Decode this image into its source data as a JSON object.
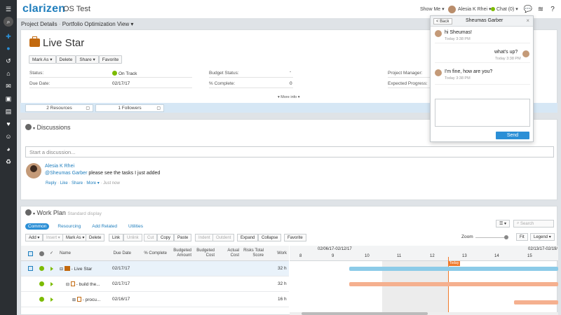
{
  "app": {
    "logo_text": "clarizen",
    "title": "OS Test"
  },
  "header": {
    "show_me": "Show Me ▾",
    "user_name": "Alesia K Rhei ▾",
    "chat_label": "Chat (0) ▾"
  },
  "breadcrumb": {
    "project_details": "Project Details",
    "separator": "·",
    "view": "Portfolio Optimization View ▾"
  },
  "project": {
    "title": "Live Star",
    "actions": [
      "Mark As ▾",
      "Delete",
      "Share ▾",
      "Favorite"
    ],
    "fields": {
      "status_label": "Status:",
      "status_value": "On Track",
      "due_label": "Due Date:",
      "due_value": "02/17/17",
      "budget_status_label": "Budget Status:",
      "budget_status_value": "-",
      "pct_complete_label": "% Complete:",
      "pct_complete_value": "0",
      "manager_label": "Project Manager:",
      "expected_label": "Expected Progress:"
    },
    "more_info": "▾ More info ▾",
    "resources": "2 Resources",
    "followers": "1 Followers"
  },
  "discussions": {
    "title": "Discussions",
    "placeholder": "Start a discussion...",
    "post": {
      "author": "Alesia K Rhei",
      "mention": "@Sheumas Garber",
      "text": " please see the tasks I just added",
      "actions": {
        "reply": "Reply",
        "like": "Like",
        "share": "Share",
        "more": "More ▾",
        "time": "Just now"
      },
      "dot": "·"
    }
  },
  "chat": {
    "back": "< Back",
    "name": "Sheumas Garber",
    "close": "×",
    "messages": [
      {
        "text": "hi Sheumas!",
        "time": "Today 3:38 PM"
      },
      {
        "text": "what's up?",
        "time": "Today 3:38 PM"
      },
      {
        "text": "I'm fine, how are you?",
        "time": "Today 3:38 PM"
      }
    ],
    "send": "Send"
  },
  "workplan": {
    "title": "Work Plan",
    "subtitle": "Standard display",
    "tabs": [
      "Common",
      "Resourcing",
      "Add Related",
      "Utilities"
    ],
    "toolbar": [
      "Add ▾",
      "Insert ▾",
      "Mark As ▾",
      "Delete",
      "Link",
      "Unlink",
      "Cut",
      "Copy",
      "Paste",
      "Indent",
      "Outdent",
      "Expand",
      "Collapse",
      "Favorite"
    ],
    "search_placeholder": "Search",
    "zoom_label": "Zoom",
    "fit": "Fit",
    "legend": "Legend ▾",
    "columns": [
      "Name",
      "Due Date",
      "% Complete",
      "Budgeted Amount",
      "Budgeted Cost",
      "Actual Cost",
      "Risks Total Score",
      "Work"
    ],
    "gantt_weeks": [
      "02/06/17-02/12/17",
      "02/13/17-02/19/"
    ],
    "gantt_days": [
      "8",
      "9",
      "10",
      "11",
      "12",
      "13",
      "14",
      "15"
    ],
    "today_label": "Today",
    "rows": [
      {
        "name": "Live Star",
        "due": "02/17/17",
        "work": "32 h"
      },
      {
        "name": "build the...",
        "due": "02/17/17",
        "work": "32 h"
      },
      {
        "name": "procu...",
        "due": "02/16/17",
        "work": "16 h"
      }
    ]
  },
  "colors": {
    "accent": "#2b8fd6",
    "sidebar": "#2b2f33",
    "on_track": "#7cbb00",
    "gantt_blue": "#8ccbe8",
    "gantt_orange": "#f5b08f",
    "today_line": "#f07a2b"
  }
}
